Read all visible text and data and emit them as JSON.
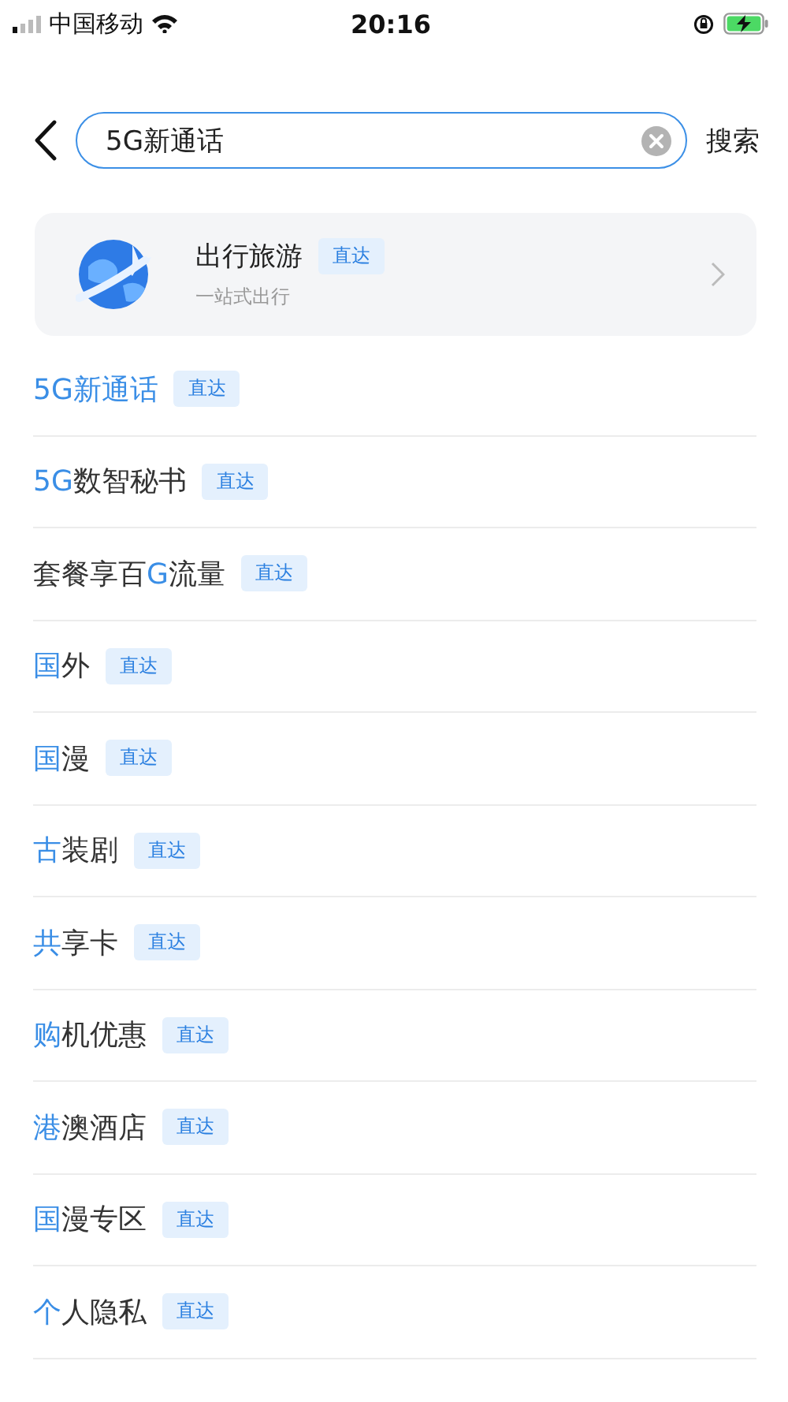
{
  "status_bar": {
    "carrier": "中国移动",
    "time": "20:16"
  },
  "search": {
    "value": "5G新通话",
    "submit": "搜索"
  },
  "feature_card": {
    "title": "出行旅游",
    "badge": "直达",
    "subtitle": "一站式出行"
  },
  "suggestions": [
    {
      "parts": [
        {
          "text": "5G新通话",
          "highlighted": true
        }
      ],
      "badge": "直达"
    },
    {
      "parts": [
        {
          "text": "5G",
          "highlighted": true
        },
        {
          "text": "数智秘书",
          "highlighted": false
        }
      ],
      "badge": "直达"
    },
    {
      "parts": [
        {
          "text": "套餐享百",
          "highlighted": false
        },
        {
          "text": "G",
          "highlighted": true
        },
        {
          "text": "流量",
          "highlighted": false
        }
      ],
      "badge": "直达"
    },
    {
      "parts": [
        {
          "text": "国",
          "highlighted": true
        },
        {
          "text": "外",
          "highlighted": false
        }
      ],
      "badge": "直达"
    },
    {
      "parts": [
        {
          "text": "国",
          "highlighted": true
        },
        {
          "text": "漫",
          "highlighted": false
        }
      ],
      "badge": "直达"
    },
    {
      "parts": [
        {
          "text": "古",
          "highlighted": true
        },
        {
          "text": "装剧",
          "highlighted": false
        }
      ],
      "badge": "直达"
    },
    {
      "parts": [
        {
          "text": "共",
          "highlighted": true
        },
        {
          "text": "享卡",
          "highlighted": false
        }
      ],
      "badge": "直达"
    },
    {
      "parts": [
        {
          "text": "购",
          "highlighted": true
        },
        {
          "text": "机优惠",
          "highlighted": false
        }
      ],
      "badge": "直达"
    },
    {
      "parts": [
        {
          "text": "港",
          "highlighted": true
        },
        {
          "text": "澳酒店",
          "highlighted": false
        }
      ],
      "badge": "直达"
    },
    {
      "parts": [
        {
          "text": "国",
          "highlighted": true
        },
        {
          "text": "漫专区",
          "highlighted": false
        }
      ],
      "badge": "直达"
    },
    {
      "parts": [
        {
          "text": "个",
          "highlighted": true
        },
        {
          "text": "人隐私",
          "highlighted": false
        }
      ],
      "badge": "直达"
    }
  ]
}
